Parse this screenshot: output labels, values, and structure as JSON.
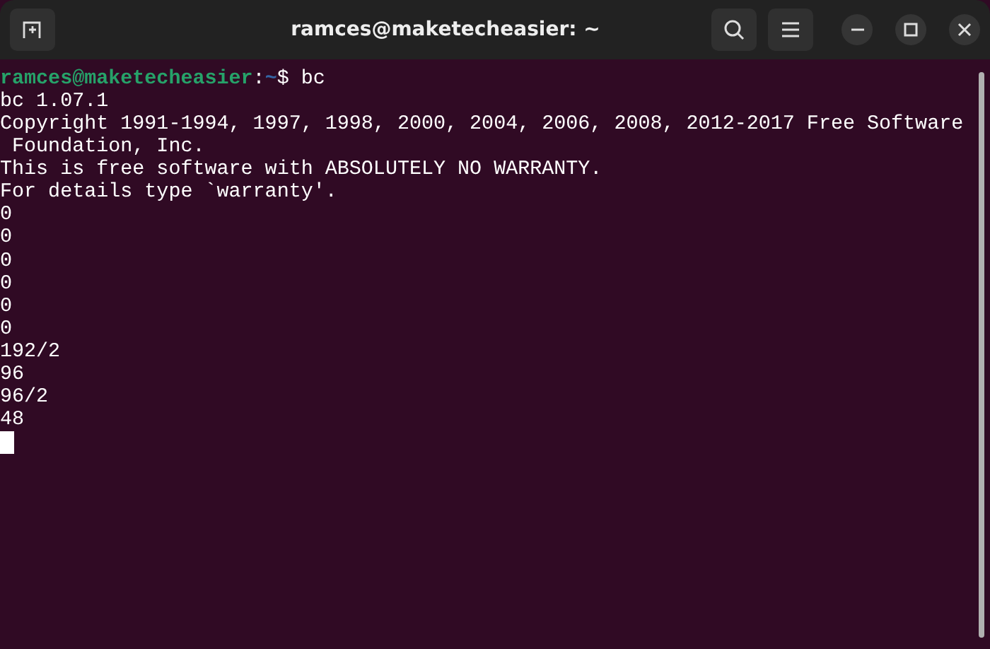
{
  "window": {
    "title": "ramces@maketecheasier: ~"
  },
  "prompt": {
    "user_host": "ramces@maketecheasier",
    "separator": ":",
    "path": "~",
    "symbol": "$",
    "command": "bc"
  },
  "lines": [
    "bc 1.07.1",
    "Copyright 1991-1994, 1997, 1998, 2000, 2004, 2006, 2008, 2012-2017 Free Software",
    " Foundation, Inc.",
    "This is free software with ABSOLUTELY NO WARRANTY.",
    "For details type `warranty'.",
    "0",
    "0",
    "0",
    "0",
    "0",
    "0",
    "192/2",
    "96",
    "96/2",
    "48"
  ]
}
